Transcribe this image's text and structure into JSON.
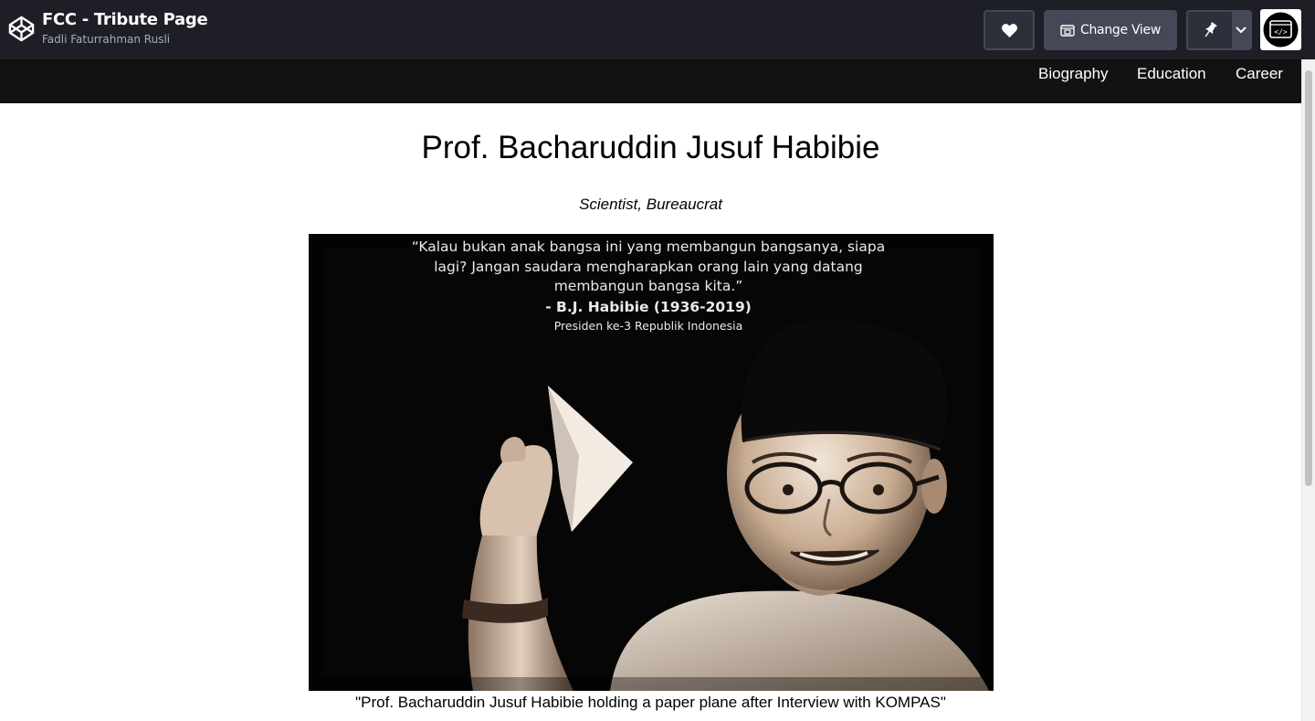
{
  "header": {
    "pen_title": "FCC - Tribute Page",
    "author": "Fadli Faturrahman Rusli",
    "change_view_label": "Change View"
  },
  "nav": {
    "links": [
      "Biography",
      "Education",
      "Career"
    ]
  },
  "main": {
    "title": "Prof. Bacharuddin Jusuf Habibie",
    "subtitle": "Scientist, Bureaucrat",
    "image": {
      "quote_lines": [
        "“Kalau bukan anak bangsa ini yang membangun bangsanya, siapa",
        "lagi? Jangan saudara mengharapkan orang lain yang datang",
        "membangun bangsa kita.”"
      ],
      "quote_author": "- B.J. Habibie (1936-2019)",
      "quote_role": "Presiden ke-3 Republik Indonesia"
    },
    "caption": "\"Prof. Bacharuddin Jusuf Habibie holding a paper plane after Interview with KOMPAS\""
  },
  "icons": {
    "logo": "codepen-logo-icon",
    "heart": "heart-icon",
    "view": "change-view-icon",
    "pin": "pin-icon",
    "caret": "chevron-down-icon",
    "avatar": "code-avatar-icon"
  },
  "colors": {
    "header_bg": "#1e1f26",
    "nav_bg": "#121212",
    "button_bg": "#444857",
    "text": "#000000"
  }
}
